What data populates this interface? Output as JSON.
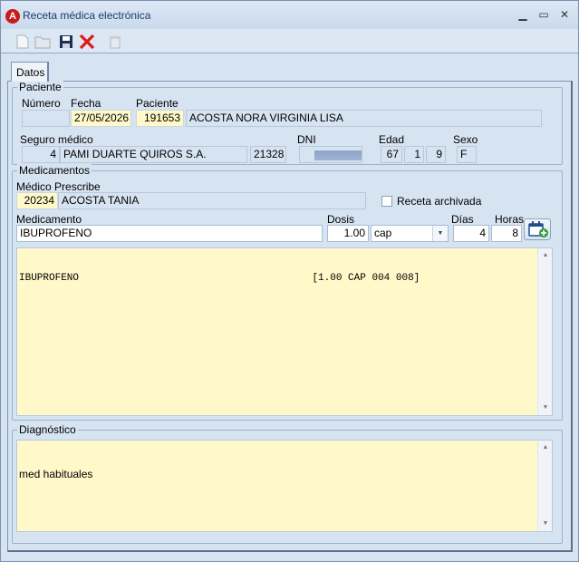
{
  "window": {
    "title": "Receta médica electrónica",
    "icon": "app-logo-icon",
    "controls": [
      "minimize-icon",
      "maximize-icon",
      "close-icon"
    ]
  },
  "toolbar": {
    "buttons": [
      {
        "name": "new-document-icon",
        "enabled": false
      },
      {
        "name": "open-folder-icon",
        "enabled": false
      },
      {
        "name": "save-icon",
        "enabled": true
      },
      {
        "name": "delete-x-icon",
        "enabled": true,
        "color": "#e01818"
      },
      {
        "name": "trash-icon",
        "enabled": false
      }
    ]
  },
  "tabs": [
    {
      "label": "Datos",
      "active": true
    }
  ],
  "paciente": {
    "group_title": "Paciente",
    "numero_label": "Número",
    "numero": "",
    "fecha_label": "Fecha",
    "fecha": "27/05/2026",
    "paciente_label": "Paciente",
    "paciente_id": "191653",
    "paciente_nombre": "ACOSTA NORA VIRGINIA LISA",
    "seguro_label": "Seguro médico",
    "seguro_num": "4",
    "seguro_nombre": "PAMI DUARTE QUIROS S.A.",
    "seguro_codigo": "21328",
    "dni_label": "DNI",
    "edad_label": "Edad",
    "edad_anios": "67",
    "edad_meses": "1",
    "edad_dias": "9",
    "sexo_label": "Sexo",
    "sexo": "F"
  },
  "medicamentos": {
    "group_title": "Medicamentos",
    "medico_label": "Médico Prescribe",
    "medico_id": "20234",
    "medico_nombre": "ACOSTA TANIA",
    "archivada_label": "Receta archivada",
    "archivada": false,
    "medicamento_label": "Medicamento",
    "medicamento": "IBUPROFENO",
    "dosis_label": "Dosis",
    "dosis": "1.00",
    "unidad": "cap",
    "dias_label": "Días",
    "dias": "4",
    "horas_label": "Horas",
    "horas": "8",
    "add_calendar_icon": "calendar-add-icon",
    "lista": "IBUPROFENO                                       [1.00 CAP 004 008]"
  },
  "diagnostico": {
    "group_title": "Diagnóstico",
    "texto": "med habituales"
  },
  "colors": {
    "window_bg": "#d6e3f1",
    "field_yellow": "#fff9c9",
    "title_text": "#1c3d6e"
  }
}
